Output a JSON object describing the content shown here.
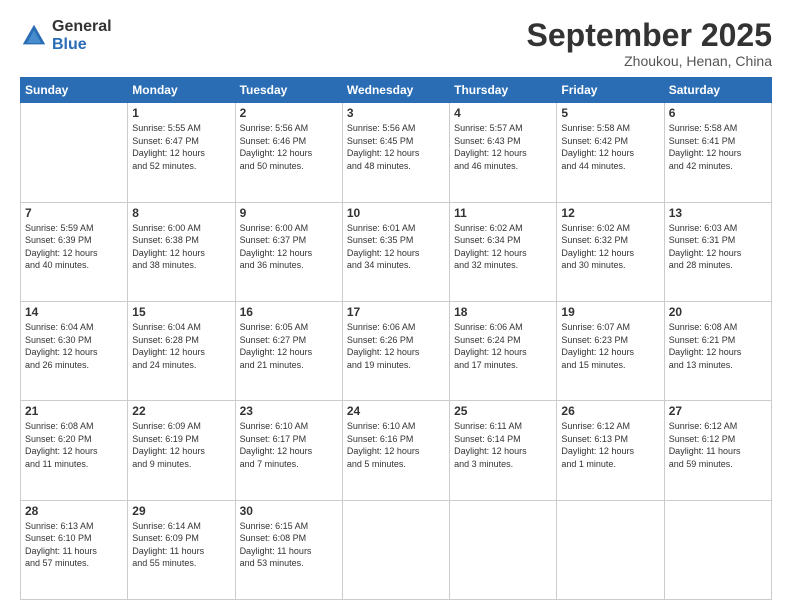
{
  "logo": {
    "general": "General",
    "blue": "Blue"
  },
  "header": {
    "month": "September 2025",
    "location": "Zhoukou, Henan, China"
  },
  "days": [
    "Sunday",
    "Monday",
    "Tuesday",
    "Wednesday",
    "Thursday",
    "Friday",
    "Saturday"
  ],
  "weeks": [
    [
      {
        "day": "",
        "info": ""
      },
      {
        "day": "1",
        "info": "Sunrise: 5:55 AM\nSunset: 6:47 PM\nDaylight: 12 hours\nand 52 minutes."
      },
      {
        "day": "2",
        "info": "Sunrise: 5:56 AM\nSunset: 6:46 PM\nDaylight: 12 hours\nand 50 minutes."
      },
      {
        "day": "3",
        "info": "Sunrise: 5:56 AM\nSunset: 6:45 PM\nDaylight: 12 hours\nand 48 minutes."
      },
      {
        "day": "4",
        "info": "Sunrise: 5:57 AM\nSunset: 6:43 PM\nDaylight: 12 hours\nand 46 minutes."
      },
      {
        "day": "5",
        "info": "Sunrise: 5:58 AM\nSunset: 6:42 PM\nDaylight: 12 hours\nand 44 minutes."
      },
      {
        "day": "6",
        "info": "Sunrise: 5:58 AM\nSunset: 6:41 PM\nDaylight: 12 hours\nand 42 minutes."
      }
    ],
    [
      {
        "day": "7",
        "info": "Sunrise: 5:59 AM\nSunset: 6:39 PM\nDaylight: 12 hours\nand 40 minutes."
      },
      {
        "day": "8",
        "info": "Sunrise: 6:00 AM\nSunset: 6:38 PM\nDaylight: 12 hours\nand 38 minutes."
      },
      {
        "day": "9",
        "info": "Sunrise: 6:00 AM\nSunset: 6:37 PM\nDaylight: 12 hours\nand 36 minutes."
      },
      {
        "day": "10",
        "info": "Sunrise: 6:01 AM\nSunset: 6:35 PM\nDaylight: 12 hours\nand 34 minutes."
      },
      {
        "day": "11",
        "info": "Sunrise: 6:02 AM\nSunset: 6:34 PM\nDaylight: 12 hours\nand 32 minutes."
      },
      {
        "day": "12",
        "info": "Sunrise: 6:02 AM\nSunset: 6:32 PM\nDaylight: 12 hours\nand 30 minutes."
      },
      {
        "day": "13",
        "info": "Sunrise: 6:03 AM\nSunset: 6:31 PM\nDaylight: 12 hours\nand 28 minutes."
      }
    ],
    [
      {
        "day": "14",
        "info": "Sunrise: 6:04 AM\nSunset: 6:30 PM\nDaylight: 12 hours\nand 26 minutes."
      },
      {
        "day": "15",
        "info": "Sunrise: 6:04 AM\nSunset: 6:28 PM\nDaylight: 12 hours\nand 24 minutes."
      },
      {
        "day": "16",
        "info": "Sunrise: 6:05 AM\nSunset: 6:27 PM\nDaylight: 12 hours\nand 21 minutes."
      },
      {
        "day": "17",
        "info": "Sunrise: 6:06 AM\nSunset: 6:26 PM\nDaylight: 12 hours\nand 19 minutes."
      },
      {
        "day": "18",
        "info": "Sunrise: 6:06 AM\nSunset: 6:24 PM\nDaylight: 12 hours\nand 17 minutes."
      },
      {
        "day": "19",
        "info": "Sunrise: 6:07 AM\nSunset: 6:23 PM\nDaylight: 12 hours\nand 15 minutes."
      },
      {
        "day": "20",
        "info": "Sunrise: 6:08 AM\nSunset: 6:21 PM\nDaylight: 12 hours\nand 13 minutes."
      }
    ],
    [
      {
        "day": "21",
        "info": "Sunrise: 6:08 AM\nSunset: 6:20 PM\nDaylight: 12 hours\nand 11 minutes."
      },
      {
        "day": "22",
        "info": "Sunrise: 6:09 AM\nSunset: 6:19 PM\nDaylight: 12 hours\nand 9 minutes."
      },
      {
        "day": "23",
        "info": "Sunrise: 6:10 AM\nSunset: 6:17 PM\nDaylight: 12 hours\nand 7 minutes."
      },
      {
        "day": "24",
        "info": "Sunrise: 6:10 AM\nSunset: 6:16 PM\nDaylight: 12 hours\nand 5 minutes."
      },
      {
        "day": "25",
        "info": "Sunrise: 6:11 AM\nSunset: 6:14 PM\nDaylight: 12 hours\nand 3 minutes."
      },
      {
        "day": "26",
        "info": "Sunrise: 6:12 AM\nSunset: 6:13 PM\nDaylight: 12 hours\nand 1 minute."
      },
      {
        "day": "27",
        "info": "Sunrise: 6:12 AM\nSunset: 6:12 PM\nDaylight: 11 hours\nand 59 minutes."
      }
    ],
    [
      {
        "day": "28",
        "info": "Sunrise: 6:13 AM\nSunset: 6:10 PM\nDaylight: 11 hours\nand 57 minutes."
      },
      {
        "day": "29",
        "info": "Sunrise: 6:14 AM\nSunset: 6:09 PM\nDaylight: 11 hours\nand 55 minutes."
      },
      {
        "day": "30",
        "info": "Sunrise: 6:15 AM\nSunset: 6:08 PM\nDaylight: 11 hours\nand 53 minutes."
      },
      {
        "day": "",
        "info": ""
      },
      {
        "day": "",
        "info": ""
      },
      {
        "day": "",
        "info": ""
      },
      {
        "day": "",
        "info": ""
      }
    ]
  ]
}
